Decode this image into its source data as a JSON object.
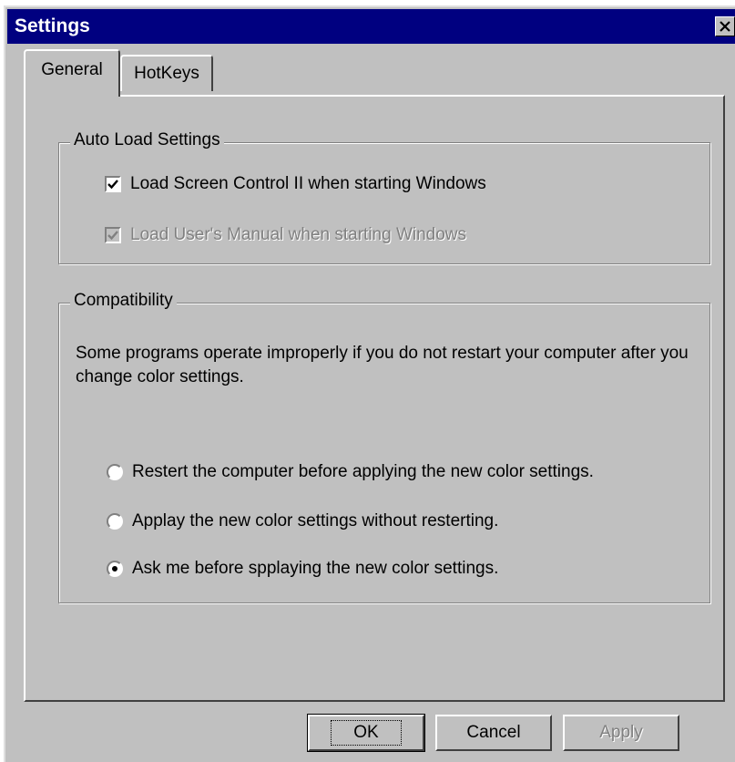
{
  "window": {
    "title": "Settings"
  },
  "tabs": [
    {
      "label": "General"
    },
    {
      "label": "HotKeys"
    }
  ],
  "auto_load": {
    "label": "Auto Load Settings",
    "options": [
      {
        "label": "Load Screen Control II when starting Windows",
        "checked": true,
        "disabled": false
      },
      {
        "label": "Load User's Manual when starting Windows",
        "checked": true,
        "disabled": true
      }
    ]
  },
  "compatibility": {
    "label": "Compatibility",
    "description": "Some programs operate improperly if you do not restart your computer after you change color settings.",
    "options": [
      {
        "label": "Restert the computer before applying the new color settings.",
        "selected": false
      },
      {
        "label": "Applay the new color settings without resterting.",
        "selected": false
      },
      {
        "label": "Ask me before spplaying the new color settings.",
        "selected": true
      }
    ]
  },
  "buttons": {
    "ok": "OK",
    "cancel": "Cancel",
    "apply": "Apply"
  },
  "colors": {
    "titlebar": "#000080",
    "face": "#c0c0c0",
    "disabled_text": "#808080"
  }
}
